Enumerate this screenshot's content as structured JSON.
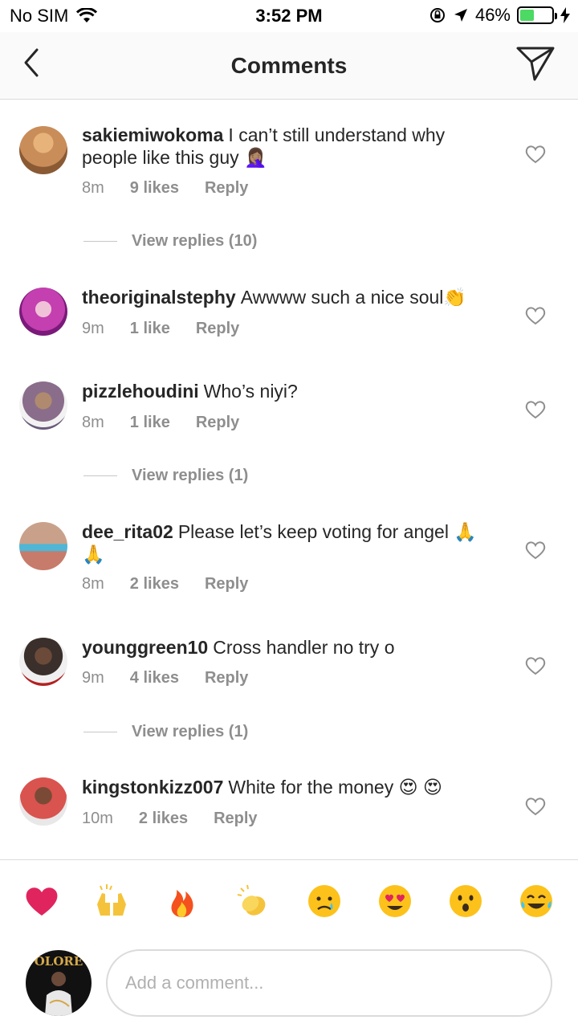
{
  "status_bar": {
    "carrier": "No SIM",
    "time": "3:52 PM",
    "battery": "46%",
    "battery_level": 0.46
  },
  "header": {
    "title": "Comments",
    "back_icon": "chevron-left-icon",
    "send_icon": "paper-plane-icon"
  },
  "comments": [
    {
      "username": "sakiemiwokoma",
      "text": "I can’t still understand why people like this guy 🤦🏽‍♀️",
      "time": "8m",
      "likes": "9 likes",
      "reply": "Reply",
      "view_replies": "View replies (10)",
      "avatar_color": "#c98d5a"
    },
    {
      "username": "theoriginalstephy",
      "text": "Awwww such a nice soul👏",
      "time": "9m",
      "likes": "1 like",
      "reply": "Reply",
      "avatar_color": "#c43fb0"
    },
    {
      "username": "pizzlehoudini",
      "text": "Who’s niyi?",
      "time": "8m",
      "likes": "1 like",
      "reply": "Reply",
      "view_replies": "View replies (1)",
      "avatar_color": "#8a6d8a"
    },
    {
      "username": "dee_rita02",
      "text": "Please let’s keep voting for angel 🙏🙏",
      "time": "8m",
      "likes": "2 likes",
      "reply": "Reply",
      "avatar_color": "#c77b6a"
    },
    {
      "username": "younggreen10",
      "text": "Cross handler no try o",
      "time": "9m",
      "likes": "4 likes",
      "reply": "Reply",
      "view_replies": "View replies (1)",
      "avatar_color": "#3a2f2a"
    },
    {
      "username": "kingstonkizz007",
      "text": "White for the money 😍 😍",
      "time": "10m",
      "likes": "2 likes",
      "reply": "Reply",
      "avatar_color": "#d9534f"
    }
  ],
  "emoji_bar": [
    "❤️",
    "🙌",
    "🔥",
    "👏",
    "😢",
    "😍",
    "😮",
    "😂"
  ],
  "composer": {
    "placeholder": "Add a comment...",
    "avatar_text": "OLORE"
  }
}
